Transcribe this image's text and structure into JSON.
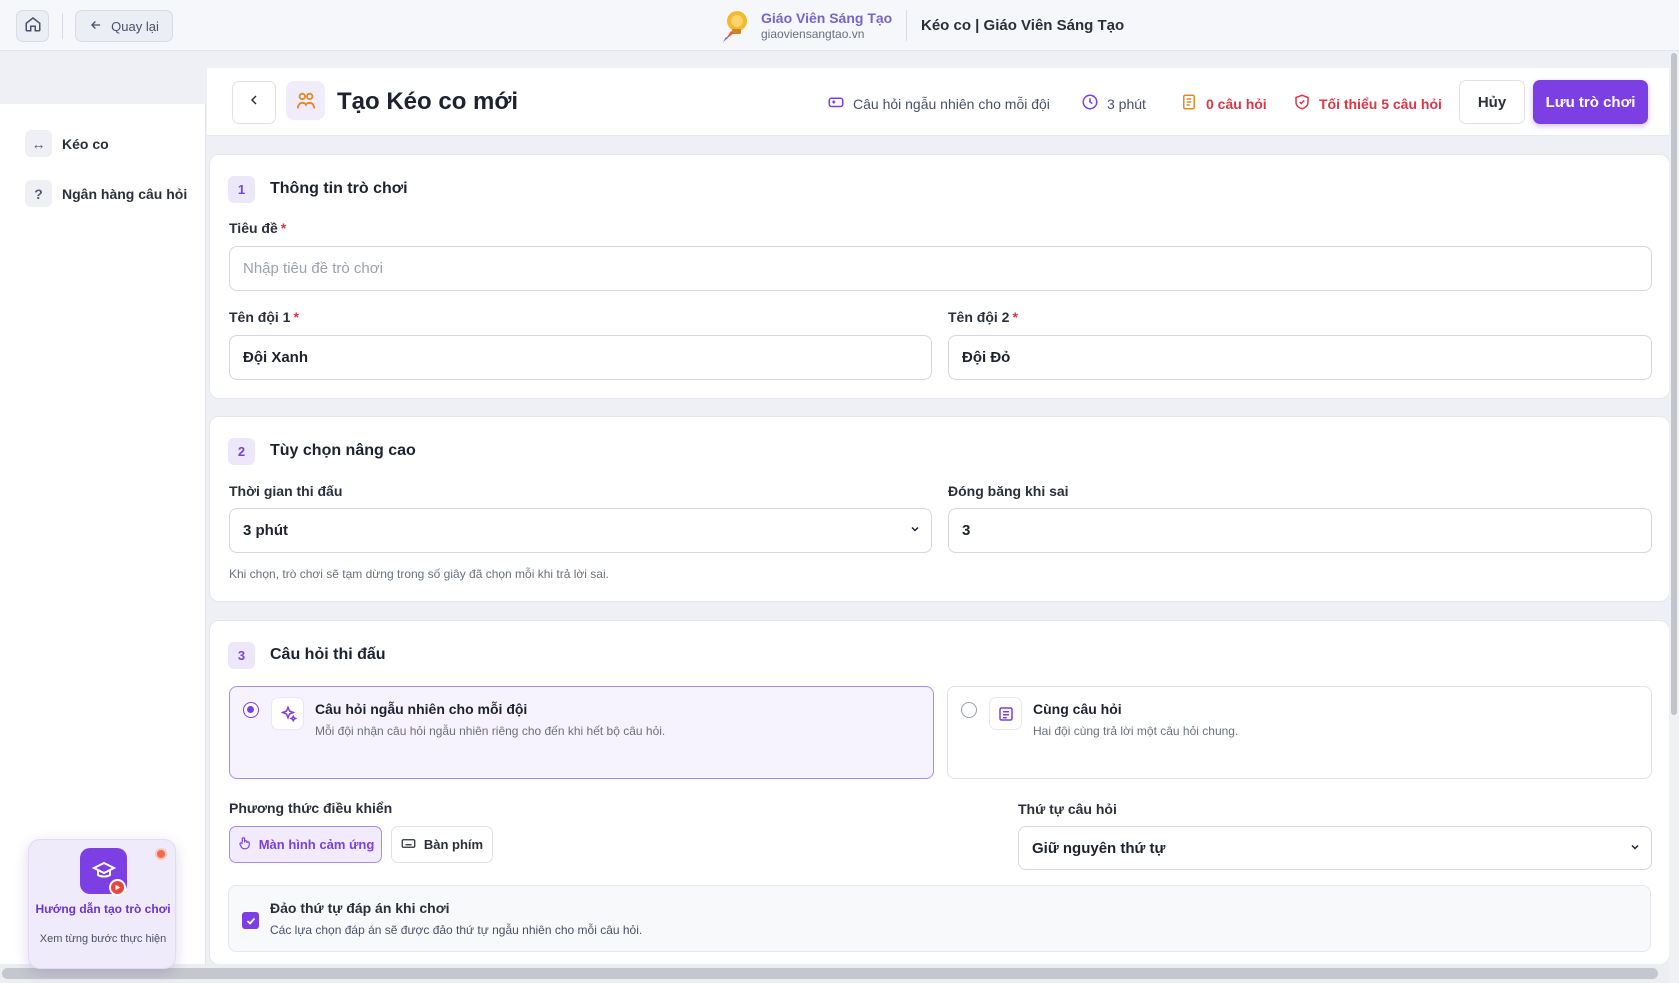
{
  "header": {
    "back_label": "Quay lại",
    "brand_name": "Giáo Viên Sáng Tạo",
    "brand_url": "giaoviensangtao.vn",
    "page_title": "Kéo co | Giáo Viên Sáng Tạo"
  },
  "sidebar": {
    "items": [
      {
        "icon": "↔",
        "label": "Kéo co"
      },
      {
        "icon": "?",
        "label": "Ngân hàng câu hỏi"
      }
    ]
  },
  "toolbar": {
    "title": "Tạo Kéo co mới",
    "mode": "Câu hỏi ngẫu nhiên cho mỗi đội",
    "duration": "3 phút",
    "question_count": "0 câu hỏi",
    "min_requirement": "Tối thiểu 5 câu hỏi",
    "cancel_label": "Hủy",
    "save_label": "Lưu trò chơi"
  },
  "section1": {
    "number": "1",
    "title": "Thông tin trò chơi",
    "title_label": "Tiêu đề",
    "title_placeholder": "Nhập tiêu đề trò chơi",
    "team1_label": "Tên đội 1",
    "team1_value": "Đội Xanh",
    "team2_label": "Tên đội 2",
    "team2_value": "Đội Đỏ",
    "required_mark": "*"
  },
  "section2": {
    "number": "2",
    "title": "Tùy chọn nâng cao",
    "time_label": "Thời gian thi đấu",
    "time_value": "3 phút",
    "freeze_label": "Đóng băng khi sai",
    "freeze_value": "3",
    "hint": "Khi chọn, trò chơi sẽ tạm dừng trong số giây đã chọn mỗi khi trả lời sai."
  },
  "section3": {
    "number": "3",
    "title": "Câu hỏi thi đấu",
    "option_random_title": "Câu hỏi ngẫu nhiên cho mỗi đội",
    "option_random_desc": "Mỗi đội nhận câu hỏi ngẫu nhiên riêng cho đến khi hết bộ câu hỏi.",
    "option_same_title": "Cùng câu hỏi",
    "option_same_desc": "Hai đội cùng trả lời một câu hỏi chung.",
    "control_label": "Phương thức điều khiển",
    "control_touch": "Màn hình cảm ứng",
    "control_keyboard": "Bàn phím",
    "order_label": "Thứ tự câu hỏi",
    "order_value": "Giữ nguyên thứ tự",
    "shuffle_title": "Đảo thứ tự đáp án khi chơi",
    "shuffle_desc": "Các lựa chọn đáp án sẽ được đảo thứ tự ngẫu nhiên cho mỗi câu hỏi."
  },
  "help_widget": {
    "title": "Hướng dẫn tạo trò chơi",
    "subtitle": "Xem từng bước thực hiện"
  },
  "colors": {
    "accent": "#7b3fe4",
    "danger": "#dc3545"
  }
}
